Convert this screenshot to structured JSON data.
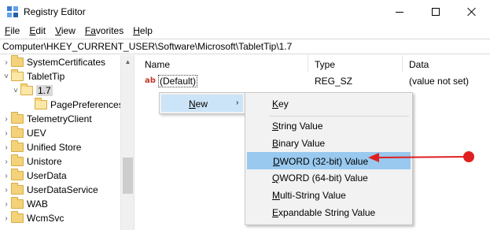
{
  "window": {
    "title": "Registry Editor",
    "controls": {
      "minimize": "minimize",
      "maximize": "maximize",
      "close": "close"
    }
  },
  "menu": [
    {
      "u": "F",
      "rest": "ile"
    },
    {
      "u": "E",
      "rest": "dit"
    },
    {
      "u": "V",
      "rest": "iew"
    },
    {
      "u": "Fa",
      "rest": "vorites",
      "u_index": 0
    },
    {
      "u": "H",
      "rest": "elp"
    }
  ],
  "menu_labels": [
    "File",
    "Edit",
    "View",
    "Favorites",
    "Help"
  ],
  "address": "Computer\\HKEY_CURRENT_USER\\Software\\Microsoft\\TabletTip\\1.7",
  "tree": [
    {
      "label": "SystemCertificates",
      "expander": ">",
      "state": "collapsed"
    },
    {
      "label": "TabletTip",
      "expander": "v",
      "state": "expanded"
    },
    {
      "label": "1.7",
      "expander": "v",
      "state": "expanded",
      "selected": true
    },
    {
      "label": "PagePreferences",
      "expander": "",
      "state": "leaf"
    },
    {
      "label": "TelemetryClient",
      "expander": ">",
      "state": "collapsed"
    },
    {
      "label": "UEV",
      "expander": ">",
      "state": "collapsed"
    },
    {
      "label": "Unified Store",
      "expander": ">",
      "state": "collapsed"
    },
    {
      "label": "Unistore",
      "expander": ">",
      "state": "collapsed"
    },
    {
      "label": "UserData",
      "expander": ">",
      "state": "collapsed"
    },
    {
      "label": "UserDataService",
      "expander": ">",
      "state": "collapsed"
    },
    {
      "label": "WAB",
      "expander": ">",
      "state": "collapsed"
    },
    {
      "label": "WcmSvc",
      "expander": ">",
      "state": "collapsed"
    }
  ],
  "columns": {
    "name": "Name",
    "type": "Type",
    "data": "Data"
  },
  "values": [
    {
      "icon": "ab",
      "name": "(Default)",
      "type": "REG_SZ",
      "data": "(value not set)"
    }
  ],
  "context_menu": {
    "new_label": "New",
    "new_underline": "N",
    "new_rest": "ew",
    "arrow": "›"
  },
  "submenu": [
    {
      "u": "K",
      "rest": "ey",
      "label": "Key"
    },
    {
      "u": "S",
      "rest": "tring Value",
      "label": "String Value"
    },
    {
      "u": "B",
      "rest": "inary Value",
      "label": "Binary Value"
    },
    {
      "u": "D",
      "rest": "WORD (32-bit) Value",
      "label": "DWORD (32-bit) Value",
      "highlighted": true
    },
    {
      "u": "Q",
      "rest": "WORD (64-bit) Value",
      "label": "QWORD (64-bit) Value"
    },
    {
      "u": "M",
      "rest": "ulti-String Value",
      "label": "Multi-String Value"
    },
    {
      "u": "E",
      "rest": "xpandable String Value",
      "label": "Expandable String Value"
    }
  ],
  "colors": {
    "annotation": "#e02020",
    "highlight": "#99c9ef",
    "new_hover": "#cce4f7",
    "folder": "#f3d27a"
  }
}
